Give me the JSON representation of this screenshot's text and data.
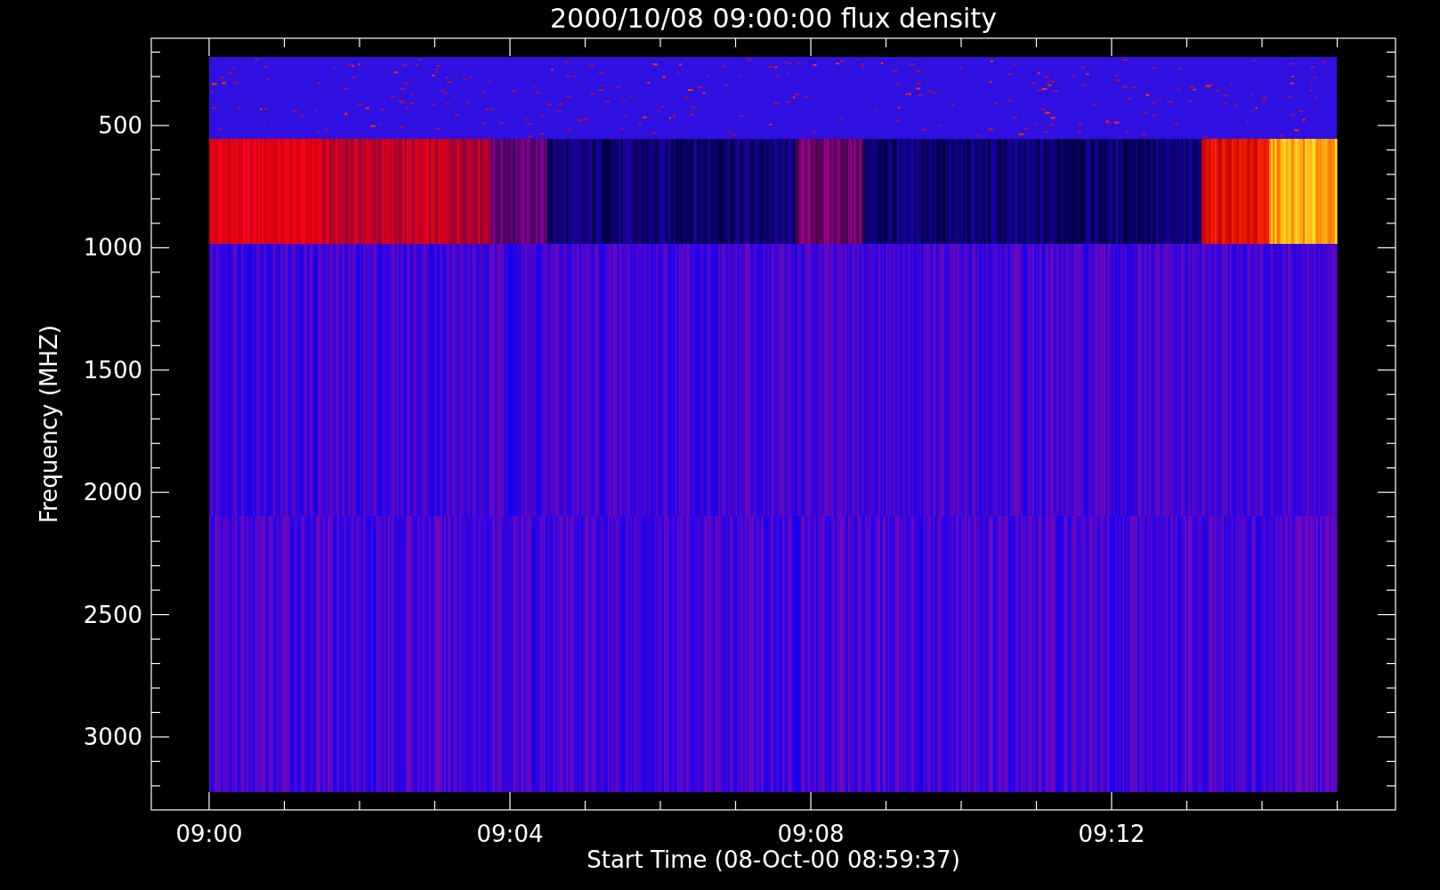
{
  "plot": {
    "title": "2000/10/08 09:00:00 flux density",
    "xlabel": "Start Time (08-Oct-00 08:59:37)",
    "ylabel": "Frequency (MHZ)",
    "xtick_labels": [
      "09:00",
      "09:04",
      "09:08",
      "09:12"
    ],
    "ytick_labels": [
      "500",
      "1000",
      "1500",
      "2000",
      "2500",
      "3000"
    ]
  }
}
